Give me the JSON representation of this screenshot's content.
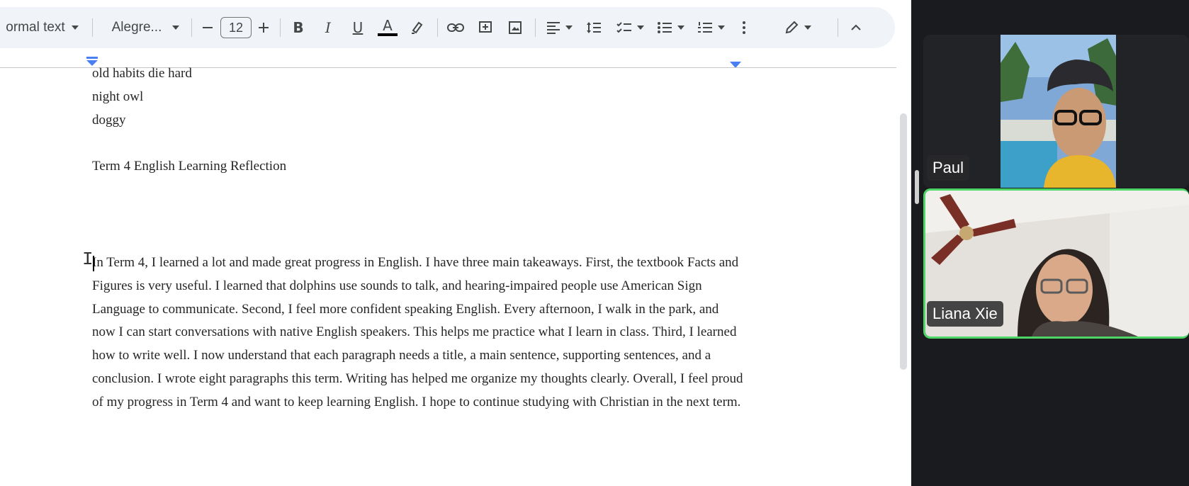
{
  "toolbar": {
    "style_label": "ormal text",
    "font_label": "Alegre...",
    "font_size": "12",
    "icons": [
      "minus-icon",
      "plus-icon",
      "bold-icon",
      "italic-icon",
      "underline-icon",
      "text-color-icon",
      "highlight-icon",
      "link-icon",
      "add-comment-icon",
      "insert-image-icon",
      "align-icon",
      "line-spacing-icon",
      "checklist-icon",
      "bullet-list-icon",
      "numbered-list-icon",
      "more-icon",
      "editing-mode-icon",
      "collapse-icon"
    ],
    "bold": "B",
    "italic": "I",
    "underline": "U",
    "text_color": "A",
    "text_color_hex": "#000000"
  },
  "document": {
    "lines": [
      "old habits die hard",
      "night owl",
      "doggy"
    ],
    "heading": "Term 4 English Learning Reflection",
    "paragraph": "In Term 4, I learned a lot and made great progress in English. I have three main takeaways. First, the textbook Facts and Figures is very useful. I learned that dolphins use sounds to talk, and hearing-impaired people use American Sign Language to communicate. Second, I feel more confident speaking English. Every afternoon, I walk in the park, and now I can start conversations with native English speakers. This helps me practice what I learn in class. Third, I learned how to write well. I now understand that each paragraph needs a title, a main sentence, supporting sentences, and a conclusion. I wrote eight paragraphs this term. Writing has helped me organize my thoughts clearly. Overall, I feel proud of my progress in Term 4 and want to keep learning English. I hope to continue studying with Christian in the next term."
  },
  "participants": [
    {
      "name": "Paul"
    },
    {
      "name": "Liana Xie",
      "active_speaker": true,
      "highlight_hex": "#4dd565"
    }
  ]
}
